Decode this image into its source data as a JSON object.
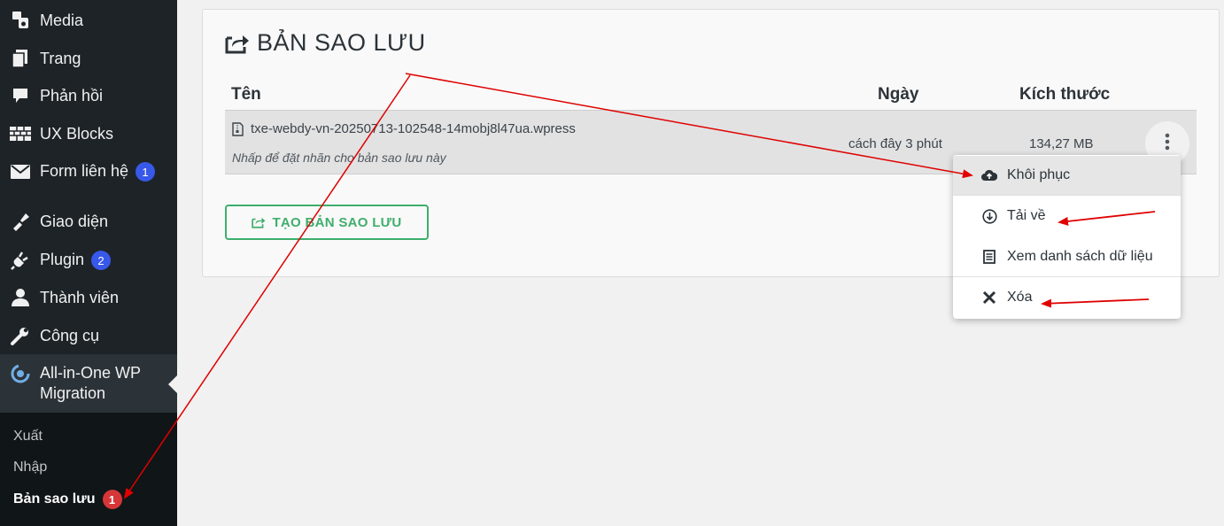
{
  "sidebar": {
    "items": [
      {
        "label": "Media",
        "icon": "media-icon"
      },
      {
        "label": "Trang",
        "icon": "pages-icon"
      },
      {
        "label": "Phản hồi",
        "icon": "comments-icon"
      },
      {
        "label": "UX Blocks",
        "icon": "ux-blocks-icon"
      },
      {
        "label": "Form liên hệ",
        "icon": "mail-icon",
        "badge": "1"
      },
      {
        "label": "Giao diện",
        "icon": "appearance-icon"
      },
      {
        "label": "Plugin",
        "icon": "plugins-icon",
        "badge": "2"
      },
      {
        "label": "Thành viên",
        "icon": "users-icon"
      },
      {
        "label": "Công cụ",
        "icon": "tools-icon"
      },
      {
        "label": "All-in-One WP Migration",
        "icon": "migration-icon"
      }
    ],
    "submenu": [
      {
        "label": "Xuất"
      },
      {
        "label": "Nhập"
      },
      {
        "label": "Bản sao lưu",
        "badge": "1"
      }
    ]
  },
  "panel": {
    "title": "BẢN SAO LƯU",
    "columns": {
      "name": "Tên",
      "date": "Ngày",
      "size": "Kích thước"
    },
    "row": {
      "filename": "txe-webdy-vn-20250713-102548-14mobj8l47ua.wpress",
      "note": "Nhấp để đặt nhãn cho bản sao lưu này",
      "date": "cách đây 3 phút",
      "size": "134,27 MB"
    },
    "create_button": "TẠO BẢN SAO LƯU"
  },
  "dropdown": {
    "items": [
      {
        "label": "Khôi phục",
        "icon": "cloud-upload-icon"
      },
      {
        "label": "Tải về",
        "icon": "download-icon"
      },
      {
        "label": "Xem danh sách dữ liệu",
        "icon": "list-icon"
      },
      {
        "label": "Xóa",
        "icon": "close-icon"
      }
    ]
  },
  "colors": {
    "sidebar_bg": "#1d2327",
    "badge_blue": "#3858e9",
    "badge_red": "#d63638",
    "accent_green": "#3fae6c",
    "annotation_red": "#e00000"
  }
}
